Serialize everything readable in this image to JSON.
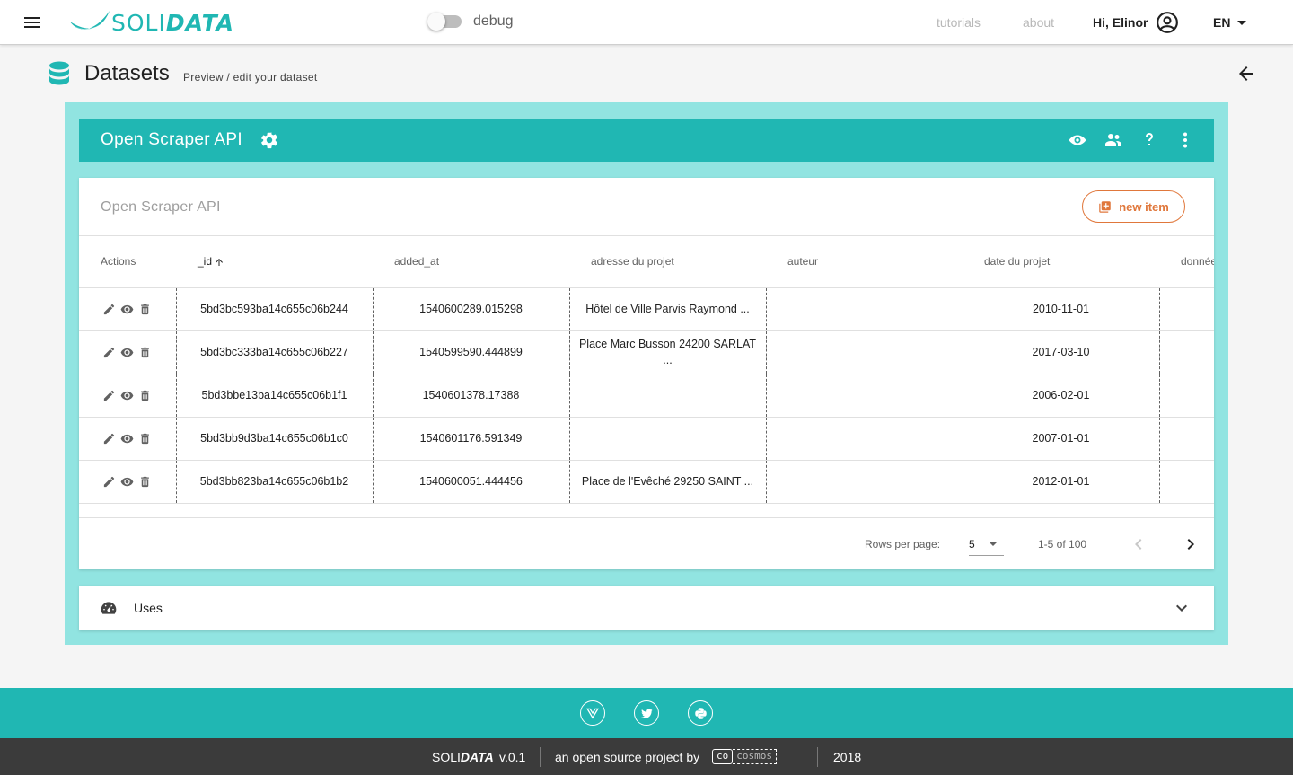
{
  "app": {
    "logo_light": "SOLI",
    "logo_bold": "DATA",
    "brand_color": "#20b7b3",
    "accent_color": "#e0773b"
  },
  "topbar": {
    "debug_label": "debug",
    "debug_on": false,
    "tutorials": "tutorials",
    "about": "about",
    "greeting": "Hi, Elinor",
    "language": "EN"
  },
  "page": {
    "title": "Datasets",
    "subtitle": "Preview / edit your dataset"
  },
  "dataset": {
    "name": "Open Scraper API",
    "card_title": "Open Scraper API",
    "new_item": "new item"
  },
  "table": {
    "headers": [
      "Actions",
      "_id",
      "added_at",
      "adresse du projet",
      "auteur",
      "date du projet",
      "donnée"
    ],
    "sort_column": "_id",
    "rows": [
      [
        "5bd3bc593ba14c655c06b244",
        "1540600289.015298",
        "Hôtel de Ville Parvis Raymond ...",
        "",
        "2010-11-01",
        ""
      ],
      [
        "5bd3bc333ba14c655c06b227",
        "1540599590.444899",
        "Place Marc Busson 24200 SARLAT ...",
        "",
        "2017-03-10",
        ""
      ],
      [
        "5bd3bbe13ba14c655c06b1f1",
        "1540601378.17388",
        "",
        "",
        "2006-02-01",
        ""
      ],
      [
        "5bd3bb9d3ba14c655c06b1c0",
        "1540601176.591349",
        "",
        "",
        "2007-01-01",
        ""
      ],
      [
        "5bd3bb823ba14c655c06b1b2",
        "1540600051.444456",
        "Place de l'Evêché 29250 SAINT ...",
        "",
        "2012-01-01",
        ""
      ]
    ]
  },
  "pagination": {
    "rows_per_page_label": "Rows per page:",
    "rows_per_page": "5",
    "range": "1-5 of 100"
  },
  "uses": {
    "label": "Uses"
  },
  "footer": {
    "logo_light": "SOLI",
    "logo_bold": "DATA",
    "version": "v.0.1",
    "tagline": "an open source project by",
    "org_logo_co": "co",
    "org_logo_rest": "cosmos",
    "year": "2018"
  }
}
